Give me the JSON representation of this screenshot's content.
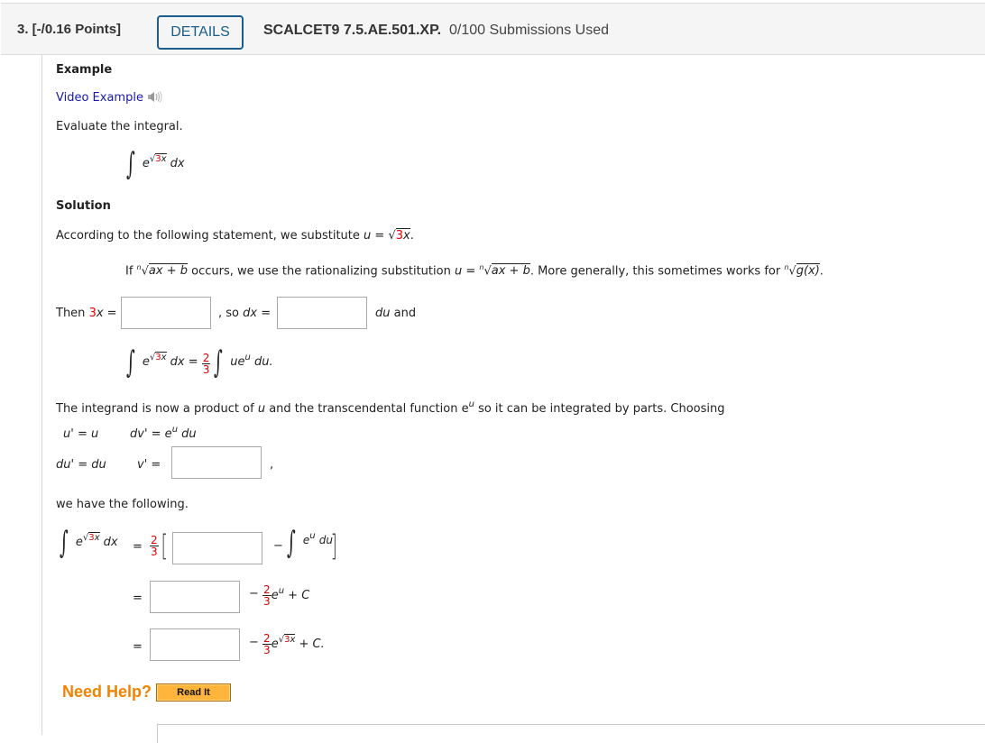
{
  "header": {
    "question_label": "3.  [-/0.16 Points]",
    "details_button": "DETAILS",
    "problem_code": "SCALCET9 7.5.AE.501.XP.",
    "submissions": "0/100 Submissions Used"
  },
  "example": {
    "heading": "Example",
    "video_link": "Video Example",
    "video_icon": "speaker-icon",
    "prompt": "Evaluate the integral.",
    "integral": {
      "base": "e",
      "radicand": "3x",
      "radicand_coef": "3",
      "radicand_var": "x",
      "differential": "dx"
    }
  },
  "solution": {
    "heading": "Solution",
    "substitution_text": "According to the following statement, we substitute ",
    "substitution_var": "u",
    "substitution_eq": " = ",
    "substitution_coef": "3",
    "substitution_x": "x",
    "substitution_end": ".",
    "rule": {
      "if": "If ",
      "root_index": "n",
      "radicand1": "ax + b",
      "middle": " occurs, we use the rationalizing substitution ",
      "u": "u",
      "eq": " = ",
      "radicand2": "ax + b",
      "more": ". More generally, this sometimes works for ",
      "radicand3": "g(x)",
      "end": "."
    },
    "then_label": "Then ",
    "then_coef": "3",
    "then_var": "x",
    "then_eq": " =",
    "so_dx": ", so ",
    "dx_label": "dx",
    "dx_eq": " =",
    "du_and_du": "du",
    "du_and": " and",
    "inputs": {
      "u_squared": "",
      "dx_expr": "",
      "v_prime": "",
      "bracket_term": "",
      "result_u": "",
      "result_x": ""
    },
    "rewrite": {
      "lhs_dx": "dx =",
      "frac_num": "2",
      "frac_den": "3",
      "rhs": "ue",
      "rhs_sup": "u",
      "rhs_du": "du."
    },
    "parts_text_1": "The integrand is now a product of ",
    "parts_u": "u",
    "parts_text_2": " and the transcendental function e",
    "parts_sup": "u",
    "parts_text_3": " so it can be integrated by parts. Choosing",
    "choices": {
      "u_prime_lhs": "u' = u",
      "dv_prime": "dv' = e",
      "dv_sup": "u",
      "dv_du": " du",
      "du_prime": "du' = du",
      "v_prime_lhs": "v' =",
      "comma": ","
    },
    "following": "we have the following.",
    "final": {
      "eq": "=",
      "frac_num": "2",
      "frac_den": "3",
      "minus": "−",
      "inner_e": "e",
      "inner_sup": "u",
      "inner_du": "du",
      "line2_tail": "e",
      "line2_sup": "u",
      "line2_c": " + C",
      "line3_tail": "e",
      "line3_c": " + C."
    }
  },
  "help": {
    "label": "Need Help?",
    "read_it": "Read It"
  },
  "colors": {
    "accent_blue": "#1b5e8c",
    "highlight_red": "#e00000",
    "help_orange": "#f08400",
    "button_orange": "#ffb43c",
    "link_blue": "#1a1aa6"
  }
}
